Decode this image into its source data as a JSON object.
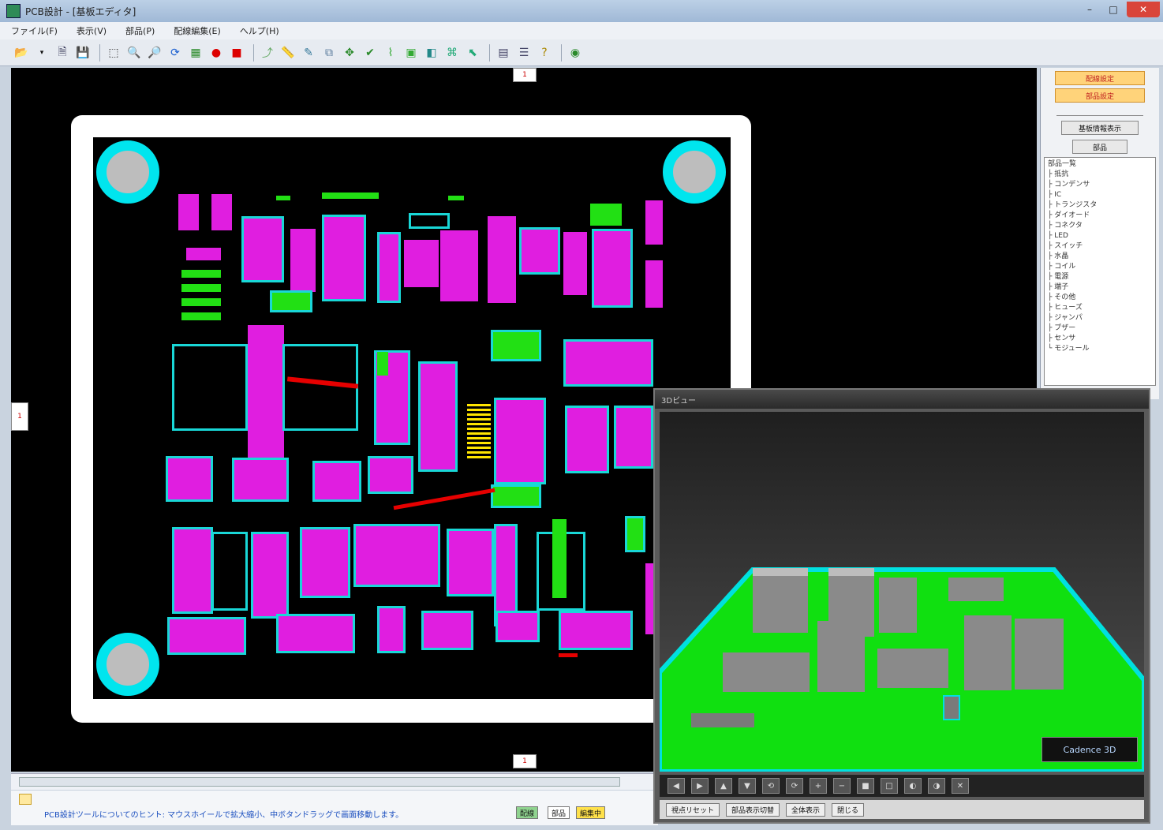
{
  "window": {
    "title": "PCB設計 - [基板エディタ]",
    "min": "–",
    "max": "□",
    "close": "✕"
  },
  "menu": [
    "ファイル(F)",
    "表示(V)",
    "部品(P)",
    "配線編集(E)",
    "ヘルプ(H)"
  ],
  "toolbar": {
    "icons": [
      "open-icon",
      "dropdown-icon",
      "save-as-icon",
      "save-icon",
      "new-icon",
      "zoom-in-icon",
      "zoom-out-icon",
      "refresh-icon",
      "grid-icon",
      "red-record-icon",
      "red-stop-icon",
      "route-icon",
      "measure-icon",
      "edit-icon",
      "copy-icon",
      "move-icon",
      "check-icon",
      "wire-icon",
      "part-icon",
      "layer-icon",
      "net-icon",
      "select-icon",
      "table-icon",
      "properties-icon",
      "help-icon",
      "globe-icon"
    ]
  },
  "rulers": {
    "top": "1",
    "left": "1",
    "bottom": "1"
  },
  "right_panel": {
    "btn1": "配線設定",
    "btn2": "部品設定",
    "btn3": "基板情報表示",
    "btn4": "部品",
    "tree": [
      "部品一覧",
      "├ 抵抗",
      "├ コンデンサ",
      "├ IC",
      "├ トランジスタ",
      "├ ダイオード",
      "├ コネクタ",
      "├ LED",
      "├ スイッチ",
      "├ 水晶",
      "├ コイル",
      "├ 電源",
      "├ 端子",
      "├ その他",
      "├ ヒューズ",
      "├ ジャンパ",
      "├ ブザー",
      "├ センサ",
      "└ モジュール"
    ]
  },
  "status": {
    "message": "PCB設計ツールについてのヒント: マウスホイールで拡大縮小、中ボタンドラッグで画面移動します。",
    "chip1": "配線",
    "chip2": "部品",
    "chip3": "編集中"
  },
  "view3d": {
    "title": "3Dビュー",
    "logo": "Cadence 3D",
    "tools": [
      "◀",
      "▶",
      "▲",
      "▼",
      "⟲",
      "⟳",
      "+",
      "−",
      "■",
      "□",
      "◐",
      "◑",
      "✕"
    ],
    "status": [
      "視点リセット",
      "部品表示切替",
      "全体表示",
      "閉じる"
    ]
  }
}
